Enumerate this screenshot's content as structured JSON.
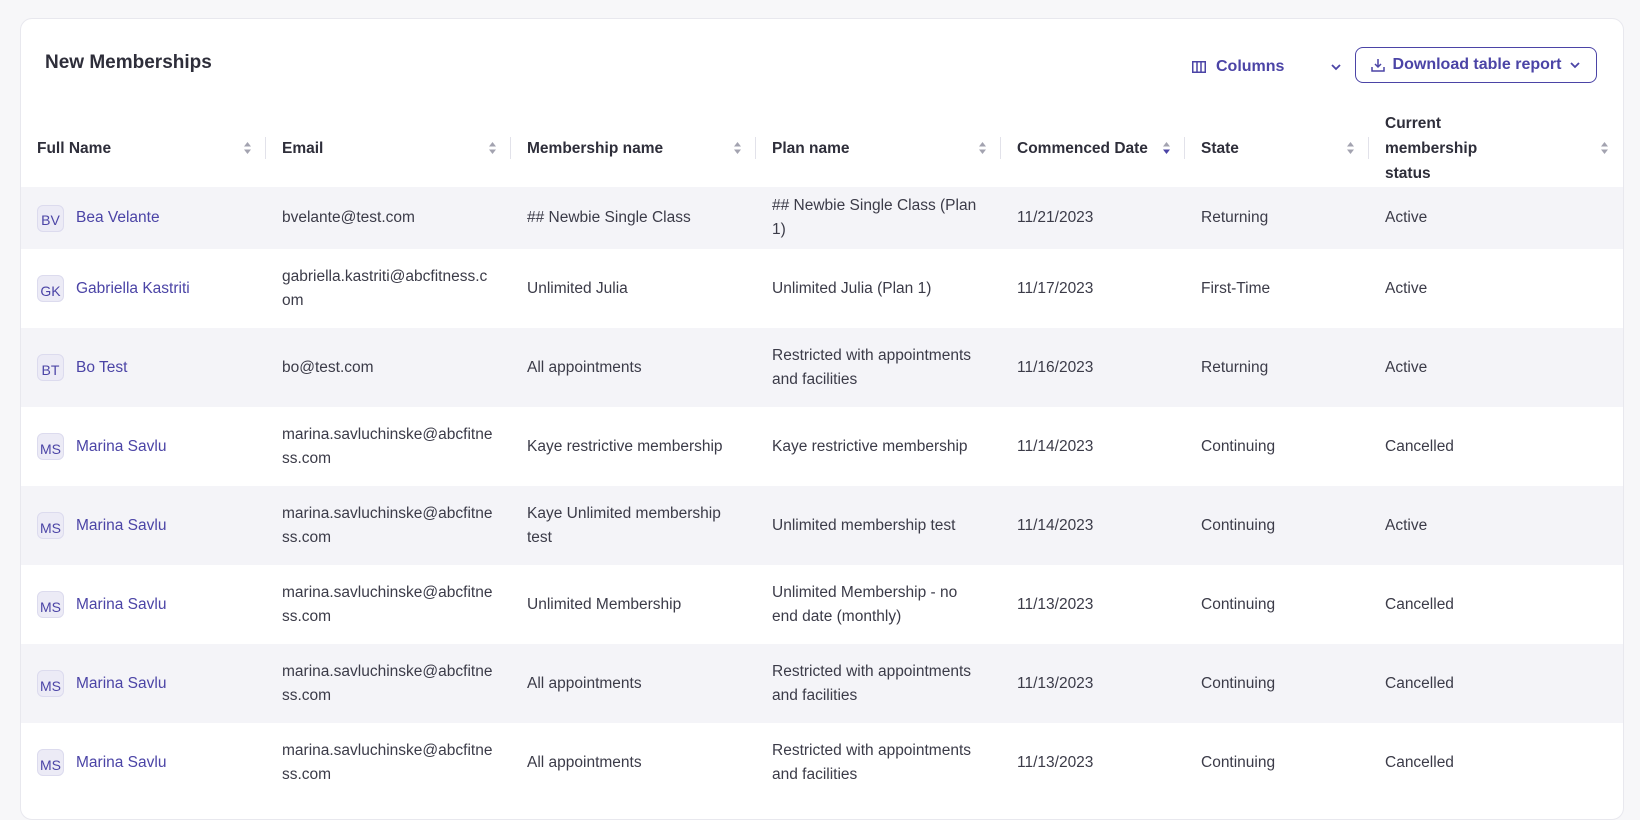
{
  "header": {
    "title": "New Memberships",
    "columns_label": "Columns",
    "download_label": "Download table report"
  },
  "table": {
    "columns": [
      "Full Name",
      "Email",
      "Membership name",
      "Plan name",
      "Commenced Date",
      "State",
      "Current membership status"
    ],
    "sorted_column": "Commenced Date",
    "rows": [
      {
        "initials": "BV",
        "name": "Bea Velante",
        "email": "bvelante@test.com",
        "membership": "## Newbie Single Class",
        "plan": "## Newbie Single Class (Plan 1)",
        "date": "11/21/2023",
        "state": "Returning",
        "status": "Active"
      },
      {
        "initials": "GK",
        "name": "Gabriella Kastriti",
        "email": "gabriella.kastriti@abcfitness.com",
        "membership": "Unlimited Julia",
        "plan": "Unlimited Julia (Plan 1)",
        "date": "11/17/2023",
        "state": "First-Time",
        "status": "Active"
      },
      {
        "initials": "BT",
        "name": "Bo Test",
        "email": "bo@test.com",
        "membership": "All appointments",
        "plan": "Restricted with appointments and facilities",
        "date": "11/16/2023",
        "state": "Returning",
        "status": "Active"
      },
      {
        "initials": "MS",
        "name": "Marina Savlu",
        "email": "marina.savluchinske@abcfitness.com",
        "membership": "Kaye restrictive membership",
        "plan": "Kaye restrictive membership",
        "date": "11/14/2023",
        "state": "Continuing",
        "status": "Cancelled"
      },
      {
        "initials": "MS",
        "name": "Marina Savlu",
        "email": "marina.savluchinske@abcfitness.com",
        "membership": "Kaye Unlimited membership test",
        "plan": "Unlimited membership test",
        "date": "11/14/2023",
        "state": "Continuing",
        "status": "Active"
      },
      {
        "initials": "MS",
        "name": "Marina Savlu",
        "email": "marina.savluchinske@abcfitness.com",
        "membership": "Unlimited Membership",
        "plan": "Unlimited Membership - no end date (monthly)",
        "date": "11/13/2023",
        "state": "Continuing",
        "status": "Cancelled"
      },
      {
        "initials": "MS",
        "name": "Marina Savlu",
        "email": "marina.savluchinske@abcfitness.com",
        "membership": "All appointments",
        "plan": "Restricted with appointments and facilities",
        "date": "11/13/2023",
        "state": "Continuing",
        "status": "Cancelled"
      },
      {
        "initials": "MS",
        "name": "Marina Savlu",
        "email": "marina.savluchinske@abcfitness.com",
        "membership": "All appointments",
        "plan": "Restricted with appointments and facilities",
        "date": "11/13/2023",
        "state": "Continuing",
        "status": "Cancelled"
      }
    ]
  },
  "icons": {
    "columns": "columns-icon",
    "download": "download-icon",
    "chevron": "chevron-down-icon",
    "sort": "sort-icon"
  },
  "colors": {
    "accent": "#4b44a6",
    "row_stripe": "#f4f4f8"
  }
}
